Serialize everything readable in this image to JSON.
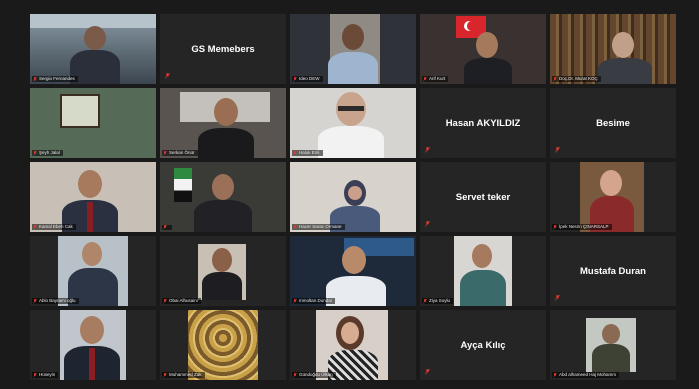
{
  "colors": {
    "background": "#1a1a1a",
    "tile": "#252525",
    "active_speaker_border": "#9fd14a",
    "muted_mic": "#e0392b"
  },
  "participants": [
    {
      "name": "Sergio Fernandes",
      "video": true
    },
    {
      "name": "GS Memebers",
      "video": false
    },
    {
      "name": "Ideo DEW",
      "video": true
    },
    {
      "name": "Arif Kurt",
      "video": true
    },
    {
      "name": "Doç.Dr. Murat KOÇ",
      "video": true
    },
    {
      "name": "Şeyh Jalal",
      "video": true
    },
    {
      "name": "Serkan Önür",
      "video": true
    },
    {
      "name": "Haluk Erik",
      "video": true
    },
    {
      "name": "Hasan AKYILDIZ",
      "video": false
    },
    {
      "name": "Besime",
      "video": false
    },
    {
      "name": "Kamal Ebeh Cak",
      "video": true
    },
    {
      "name": "",
      "video": true,
      "active": true
    },
    {
      "name": "Hacer Sarac Ormane",
      "video": true
    },
    {
      "name": "Servet teker",
      "video": false
    },
    {
      "name": "İpek Nesrin ÇINARSALP",
      "video": true
    },
    {
      "name": "Ablo Bayrami oğlu",
      "video": true
    },
    {
      "name": "Obai Alhusaini",
      "video": true
    },
    {
      "name": "mmoltan.Dundar",
      "video": true
    },
    {
      "name": "Ziya Soylu",
      "video": true
    },
    {
      "name": "Mustafa Duran",
      "video": false
    },
    {
      "name": "Hüseyin",
      "video": true
    },
    {
      "name": "Muhammed Zak",
      "video": true
    },
    {
      "name": "Gündoğdu Ülkan",
      "video": true
    },
    {
      "name": "Ayça Kılıç",
      "video": false
    },
    {
      "name": "Abd alhameed Haj Mohamm",
      "video": true
    }
  ]
}
